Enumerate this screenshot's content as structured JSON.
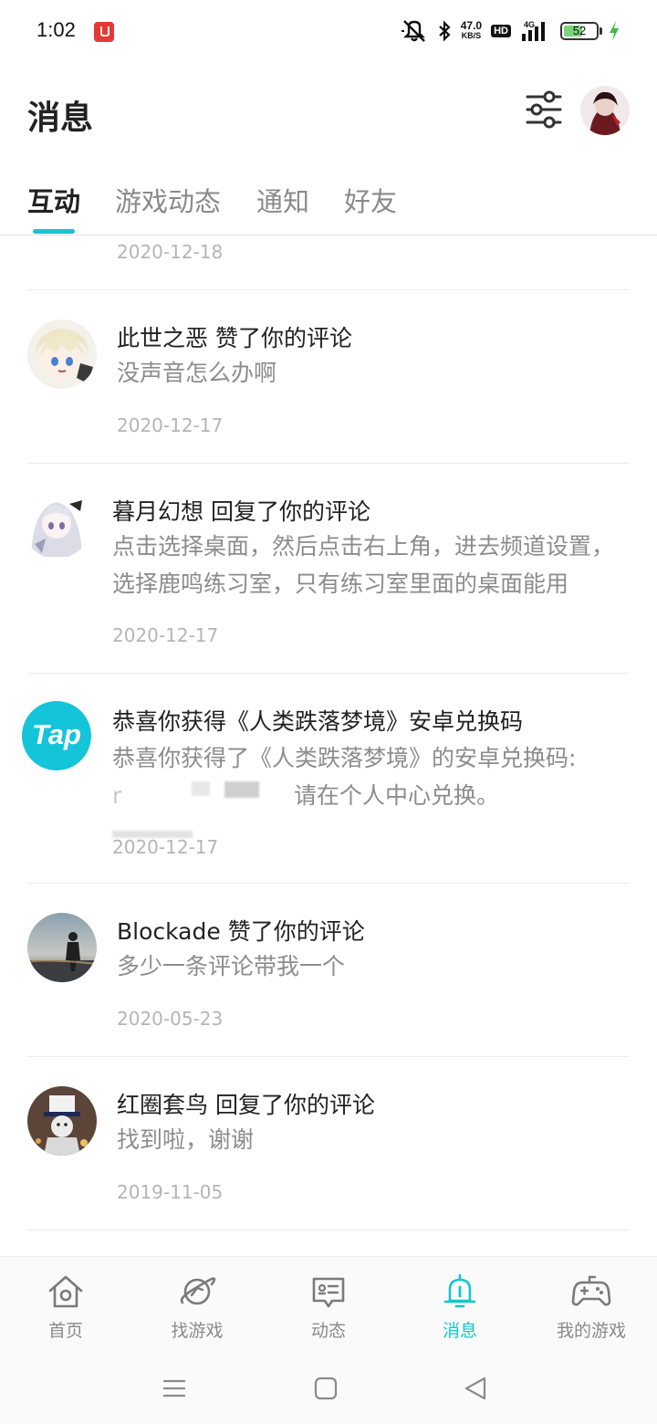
{
  "status_bar": {
    "time": "1:02",
    "net_speed_value": "47.0",
    "net_speed_unit": "KB/S",
    "hd_badge": "HD",
    "network_type": "4G",
    "battery": "52",
    "icons": [
      "mute-icon",
      "bluetooth-icon",
      "signal-icon",
      "battery-icon",
      "charging-icon"
    ]
  },
  "header": {
    "title": "消息",
    "filter_icon": "sliders-icon",
    "avatar_icon": "avatar"
  },
  "tabs": [
    {
      "label": "互动",
      "active": true
    },
    {
      "label": "游戏动态",
      "active": false
    },
    {
      "label": "通知",
      "active": false
    },
    {
      "label": "好友",
      "active": false
    }
  ],
  "partial_item_date": "2020-12-18",
  "messages": [
    {
      "title": "此世之恶 赞了你的评论",
      "body": "没声音怎么办啊",
      "date": "2020-12-17"
    },
    {
      "title": "暮月幻想 回复了你的评论",
      "body": "点击选择桌面，然后点击右上角，进去频道设置，选择鹿鸣练习室，只有练习室里面的桌面能用",
      "date": "2020-12-17"
    },
    {
      "title": "恭喜你获得《人类跌落梦境》安卓兑换码",
      "body_line1": "恭喜你获得了《人类跌落梦境》的安卓兑换码:",
      "body_line2_prefix": "r",
      "body_line2": "请在个人中心兑换。",
      "date": "2020-12-17",
      "avatar_text": "Tap"
    },
    {
      "title": "Blockade 赞了你的评论",
      "body": "多少一条评论带我一个",
      "date": "2020-05-23"
    },
    {
      "title": "红圈套鸟 回复了你的评论",
      "body": "找到啦，谢谢",
      "date": "2019-11-05"
    }
  ],
  "bottom_nav": [
    {
      "label": "首页",
      "icon": "home-icon",
      "active": false
    },
    {
      "label": "找游戏",
      "icon": "planet-icon",
      "active": false
    },
    {
      "label": "动态",
      "icon": "feed-icon",
      "active": false
    },
    {
      "label": "消息",
      "icon": "bell-icon",
      "active": true
    },
    {
      "label": "我的游戏",
      "icon": "gamepad-icon",
      "active": false
    }
  ],
  "system_nav": [
    "menu-icon",
    "home-square-icon",
    "back-triangle-icon"
  ],
  "colors": {
    "accent": "#15c5ce",
    "tap_brand": "#14c4d9",
    "text_primary": "#222222",
    "text_secondary": "#8c8c8c",
    "date": "#b5b5b5"
  }
}
